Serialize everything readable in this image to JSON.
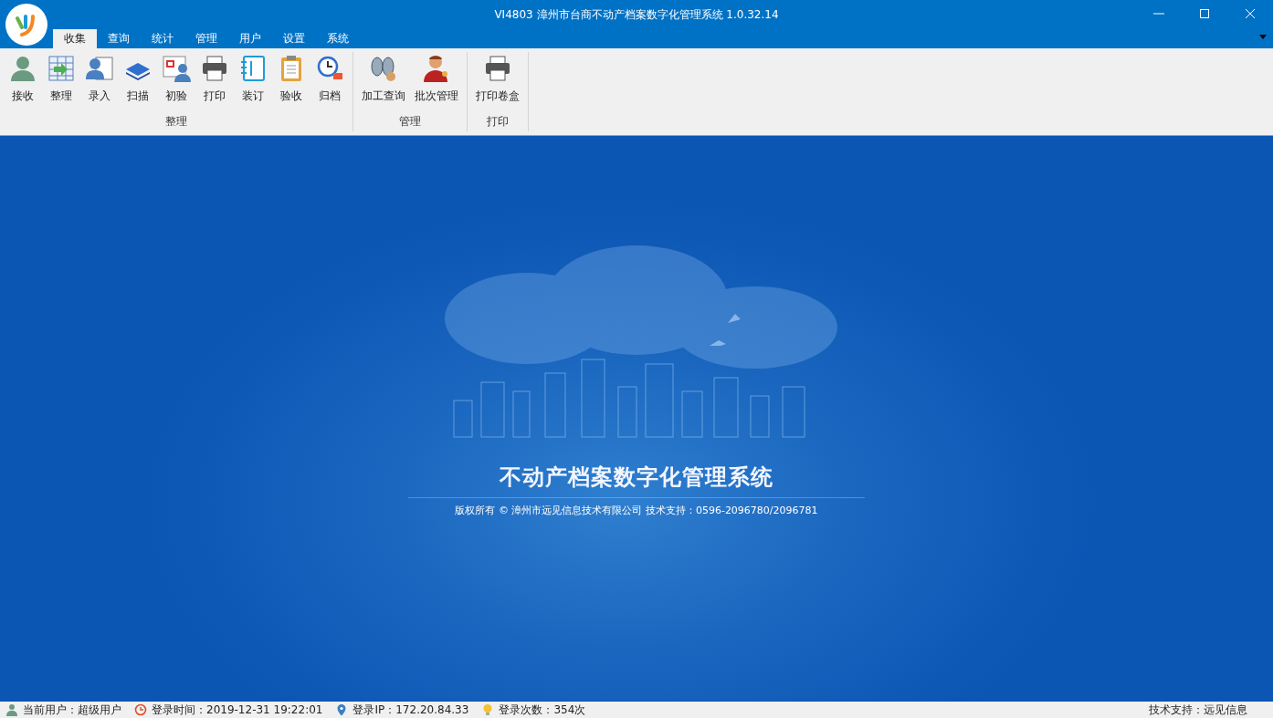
{
  "window": {
    "title": "VI4803 漳州市台商不动产档案数字化管理系统 1.0.32.14"
  },
  "tabs": [
    {
      "label": "收集",
      "selected": true
    },
    {
      "label": "查询",
      "selected": false
    },
    {
      "label": "统计",
      "selected": false
    },
    {
      "label": "管理",
      "selected": false
    },
    {
      "label": "用户",
      "selected": false
    },
    {
      "label": "设置",
      "selected": false
    },
    {
      "label": "系统",
      "selected": false
    }
  ],
  "ribbon_groups": [
    {
      "label": "整理",
      "buttons": [
        {
          "label": "接收",
          "kind": "user"
        },
        {
          "label": "整理",
          "kind": "table"
        },
        {
          "label": "录入",
          "kind": "card"
        },
        {
          "label": "扫描",
          "kind": "scanner"
        },
        {
          "label": "初验",
          "kind": "calendar"
        },
        {
          "label": "打印",
          "kind": "printer"
        },
        {
          "label": "装订",
          "kind": "notebook"
        },
        {
          "label": "验收",
          "kind": "clipboard"
        },
        {
          "label": "归档",
          "kind": "history"
        }
      ]
    },
    {
      "label": "管理",
      "buttons": [
        {
          "label": "加工查询",
          "kind": "binoculars"
        },
        {
          "label": "批次管理",
          "kind": "manager"
        }
      ]
    },
    {
      "label": "打印",
      "buttons": [
        {
          "label": "打印卷盒",
          "kind": "printer"
        }
      ]
    }
  ],
  "splash": {
    "title": "不动产档案数字化管理系统",
    "copyright": "版权所有 © 漳州市远见信息技术有限公司 技术支持：0596-2096780/2096781"
  },
  "status_bar": {
    "items": [
      {
        "kind": "user",
        "text": "当前用户：超级用户"
      },
      {
        "kind": "clock",
        "text": "登录时间：2019-12-31 19:22:01"
      },
      {
        "kind": "pin",
        "text": "登录IP：172.20.84.33"
      },
      {
        "kind": "bulb",
        "text": "登录次数：354次"
      }
    ],
    "right": "技术支持：远见信息"
  }
}
